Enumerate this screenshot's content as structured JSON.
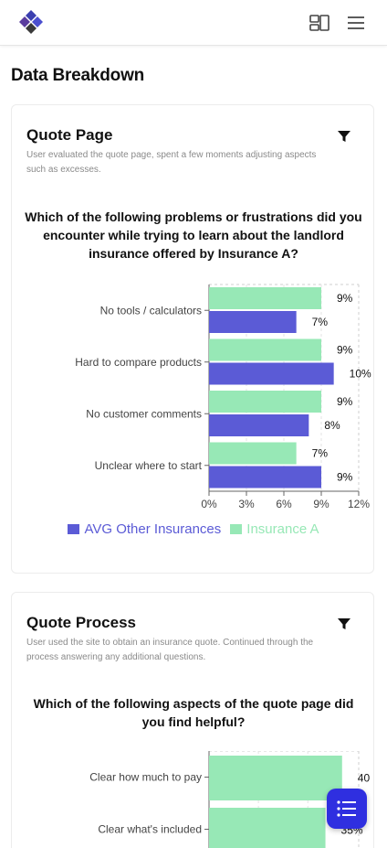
{
  "header": {
    "logo": "diamond-logo-icon",
    "buttons": [
      "grid-layout-icon",
      "hamburger-menu-icon"
    ]
  },
  "page": {
    "title": "Data Breakdown"
  },
  "colors": {
    "avg": "#5b5bd6",
    "insurance_a": "#97e8b6"
  },
  "cards": [
    {
      "title": "Quote Page",
      "description": "User evaluated the quote page, spent a few moments adjusting aspects such as excesses.",
      "question": "Which of the following problems or frustrations did you encounter while trying to learn about the landlord insurance offered by Insurance A?",
      "legend": [
        "AVG Other Insurances",
        "Insurance A"
      ]
    },
    {
      "title": "Quote Process",
      "description": "User used the site to obtain an insurance quote. Continued through the process answering any additional questions.",
      "question": "Which of the following aspects of the quote page did you find helpful?"
    }
  ],
  "chart_data": [
    {
      "type": "bar",
      "orientation": "horizontal",
      "categories": [
        "No tools / calculators",
        "Hard to compare products",
        "No customer comments",
        "Unclear where to start"
      ],
      "series": [
        {
          "name": "Insurance A",
          "values": [
            9,
            9,
            9,
            7
          ],
          "labels": [
            "9%",
            "9%",
            "9%",
            "7%"
          ],
          "color": "#97e8b6"
        },
        {
          "name": "AVG Other Insurances",
          "values": [
            7,
            10,
            8,
            9
          ],
          "labels": [
            "7%",
            "10%",
            "8%",
            "9%"
          ],
          "color": "#5b5bd6"
        }
      ],
      "xticks": [
        "0%",
        "3%",
        "6%",
        "9%",
        "12%"
      ],
      "xlim": [
        0,
        12
      ],
      "grid": true,
      "legend": "bottom"
    },
    {
      "type": "bar",
      "orientation": "horizontal",
      "categories": [
        "Clear how much to pay",
        "Clear what's included"
      ],
      "series": [
        {
          "name": "Insurance A",
          "values": [
            40,
            35
          ],
          "labels": [
            "40",
            "35%"
          ],
          "color": "#97e8b6"
        }
      ],
      "xlim": [
        0,
        45
      ],
      "grid": true
    }
  ]
}
